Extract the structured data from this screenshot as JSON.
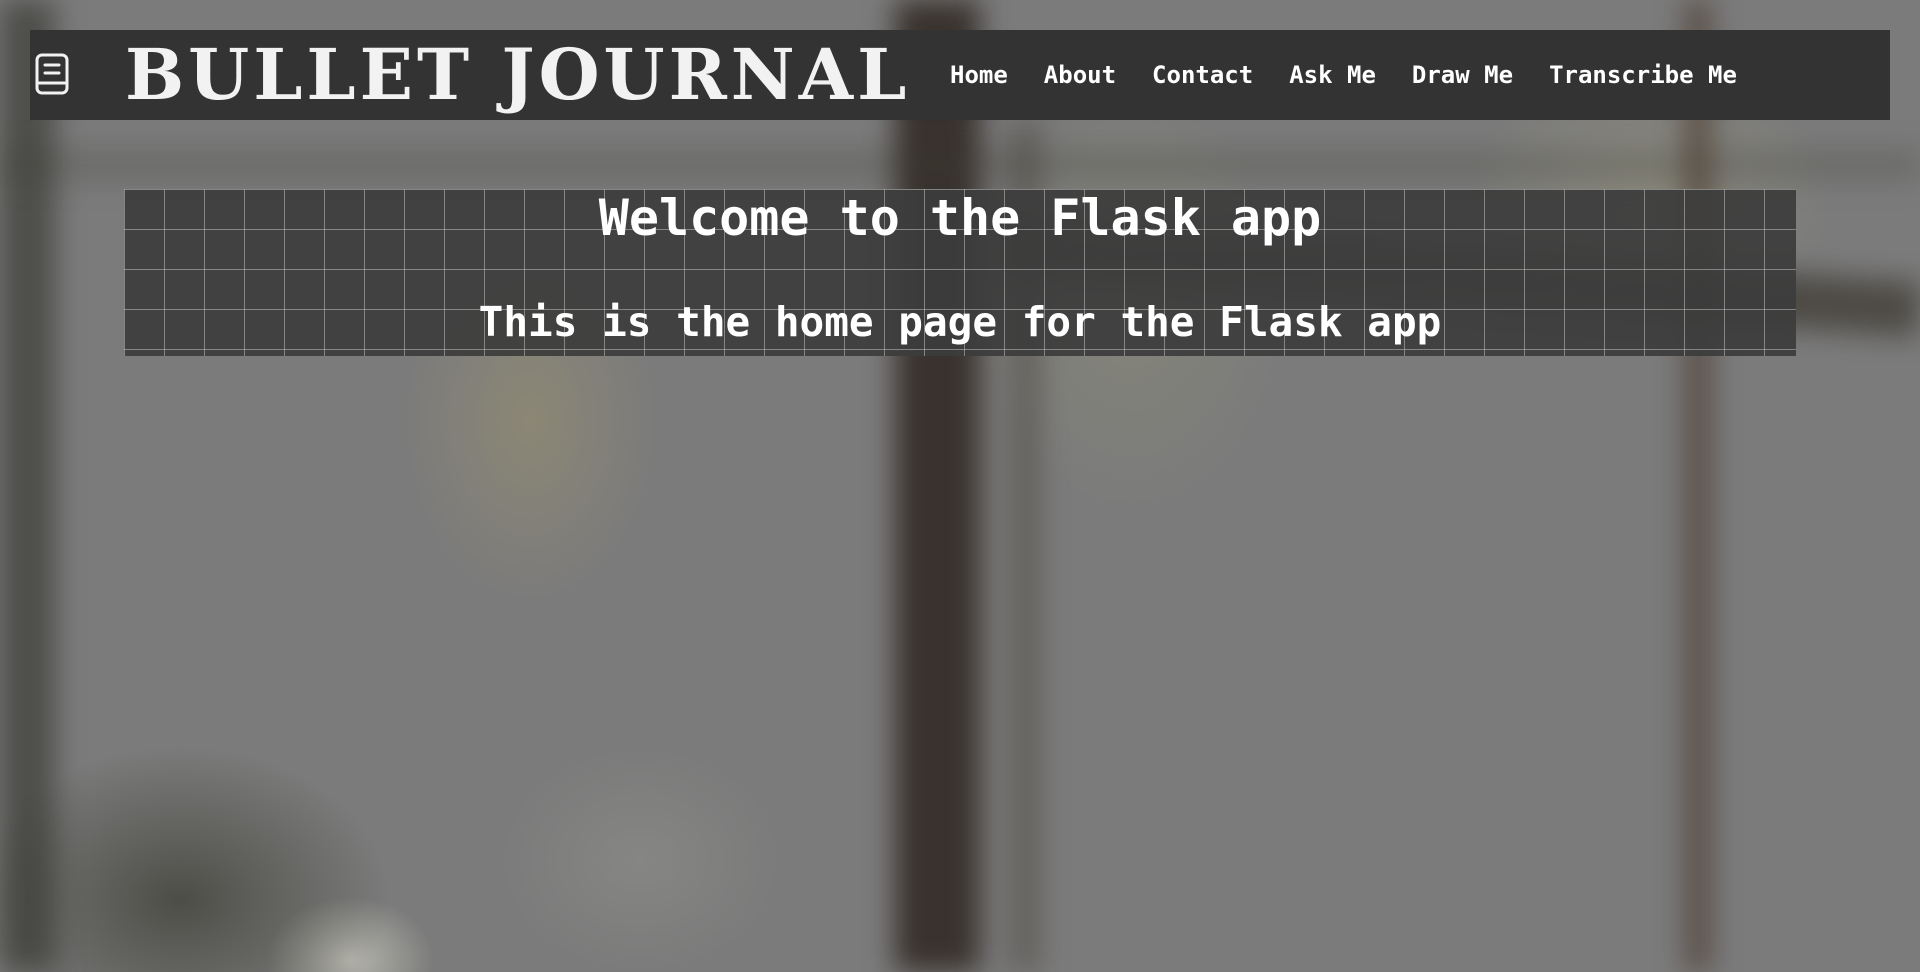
{
  "header": {
    "brand_icon": "journal-icon",
    "title": "BULLET JOURNAL",
    "nav": [
      {
        "label": "Home"
      },
      {
        "label": "About"
      },
      {
        "label": "Contact"
      },
      {
        "label": "Ask Me"
      },
      {
        "label": "Draw Me"
      },
      {
        "label": "Transcribe Me"
      }
    ]
  },
  "main": {
    "heading": "Welcome to the Flask app",
    "subtitle": "This is the home page for the Flask app"
  },
  "colors": {
    "navbar_bg": "#333333",
    "panel_bg": "#3c3c3c",
    "text": "#ffffff"
  }
}
